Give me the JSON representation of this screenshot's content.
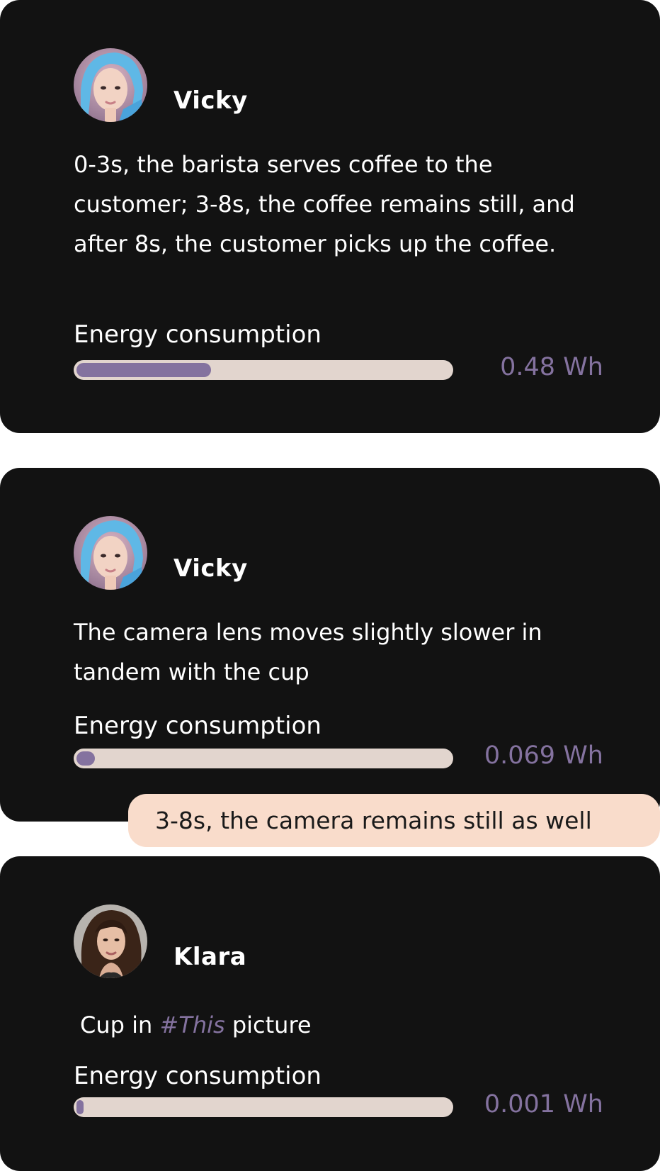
{
  "posts": [
    {
      "author": "Vicky",
      "avatar_icon": "avatar-vicky-icon",
      "message": "0-3s, the barista serves coffee to the customer; 3-8s, the coffee remains still, and after 8s, the customer picks up the coffee.",
      "energy_label": "Energy consumption",
      "energy_value": "0.48 Wh",
      "energy_fill_fraction": 0.36
    },
    {
      "author": "Vicky",
      "avatar_icon": "avatar-vicky-icon",
      "message": "The camera lens moves slightly slower in tandem with the cup",
      "energy_label": "Energy consumption",
      "energy_value": "0.069 Wh",
      "energy_fill_fraction": 0.05
    },
    {
      "author": "Klara",
      "avatar_icon": "avatar-klara-icon",
      "message_before": "Cup in",
      "message_hashtag": "#This",
      "message_after": "picture",
      "energy_label": "Energy consumption",
      "energy_value": "0.001 Wh",
      "energy_fill_fraction": 0.01
    }
  ],
  "reply": {
    "text": "3-8s, the camera remains still as well"
  },
  "colors": {
    "card_background": "#121212",
    "accent": "#84729f",
    "bar_track": "#e2d5ce",
    "reply_bubble": "#f9dccb"
  }
}
